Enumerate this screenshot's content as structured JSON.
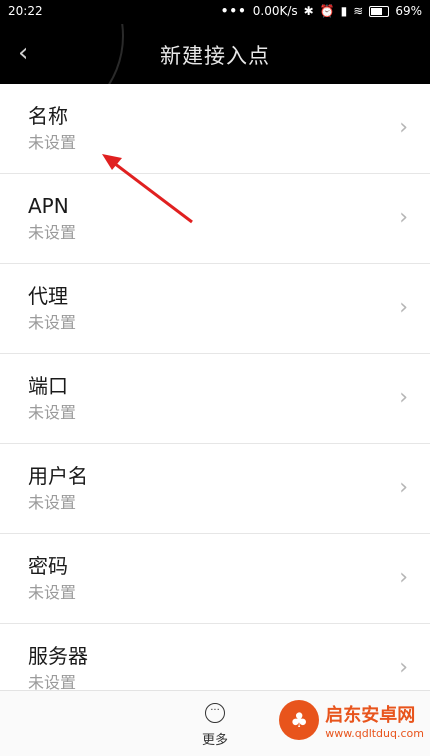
{
  "status_bar": {
    "time": "20:22",
    "network_speed": "0.00K/s",
    "battery": "69%"
  },
  "header": {
    "title": "新建接入点"
  },
  "settings": [
    {
      "label": "名称",
      "value": "未设置"
    },
    {
      "label": "APN",
      "value": "未设置"
    },
    {
      "label": "代理",
      "value": "未设置"
    },
    {
      "label": "端口",
      "value": "未设置"
    },
    {
      "label": "用户名",
      "value": "未设置"
    },
    {
      "label": "密码",
      "value": "未设置"
    },
    {
      "label": "服务器",
      "value": "未设置"
    }
  ],
  "bottom_bar": {
    "more_label": "更多"
  },
  "watermark": {
    "name": "启东安卓网",
    "url": "www.qdltduq.com"
  },
  "colors": {
    "accent_arrow": "#e02020",
    "header_bg": "#000000",
    "watermark": "#e8541c"
  }
}
